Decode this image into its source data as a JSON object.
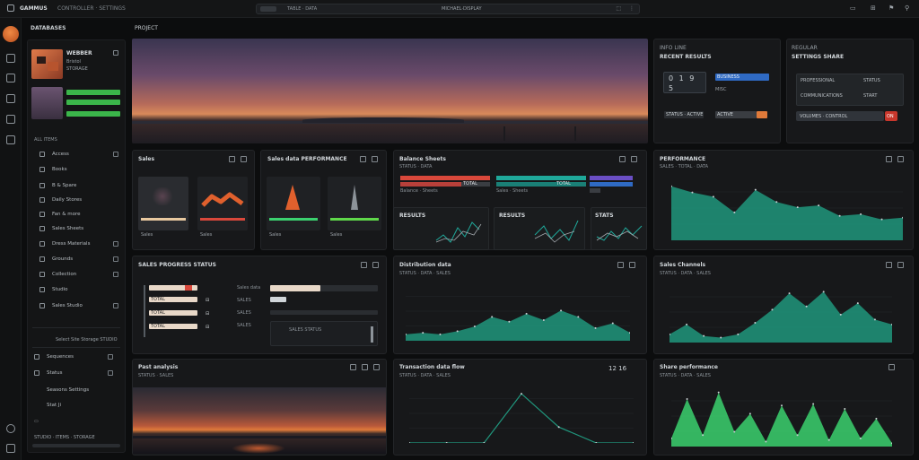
{
  "titlebar": {
    "app_name": "GAMMUS",
    "app_menu": "CONTROLLER · SETTINGS",
    "url_tab": "TABLE · DATA",
    "url_address": "MICHAEL·DISPLAY",
    "url_right_1": "⬚",
    "url_right_2": "⋮",
    "win_controls": [
      "▭",
      "⊞",
      "⚑",
      "⚲"
    ]
  },
  "sidebar": {
    "title": "DATABASES",
    "profile_name": "WEBBER",
    "profile_sub1": "Bristol",
    "profile_sub2": "STORAGE",
    "section": "ALL ITEMS",
    "items": [
      {
        "label": "Access"
      },
      {
        "label": "Books"
      },
      {
        "label": "B & Spare"
      },
      {
        "label": "Daily Stores"
      },
      {
        "label": "Fan & more"
      },
      {
        "label": "Sales Sheets"
      },
      {
        "label": "Dress Materials"
      },
      {
        "label": "Grounds"
      },
      {
        "label": "Collection"
      },
      {
        "label": "Studio"
      },
      {
        "label": "Sales Studio"
      }
    ],
    "footer_line": "Select Site Storage STUDIO",
    "footer_items": [
      {
        "label": "Sequences"
      },
      {
        "label": "Status"
      },
      {
        "label": "Seasons Settings"
      },
      {
        "label": "Stat Ji"
      }
    ],
    "footer_caption": "STUDIO · ITEMS · STORAGE"
  },
  "main": {
    "title": "PROJECT"
  },
  "panel_right_top1": {
    "title": "INFO LINE",
    "subtitle": "RECENT RESULTS",
    "digits": "0 1 9",
    "digits2": "5",
    "row1": "BUSINESS",
    "row2": "MISC",
    "row3": "STATUS · ACTIVE",
    "row4": "ACTIVE"
  },
  "panel_right_top2": {
    "title": "REGULAR",
    "subtitle": "SETTINGS SHARE",
    "line1": "PROFESSIONAL",
    "line1b": "STATUS",
    "line2": "COMMUNICATIONS",
    "line2b": "START",
    "line3": "VOLUMES · CONTROL",
    "line3b": "ON"
  },
  "card_b1": {
    "title": "Sales",
    "foot1": "Sales",
    "foot2": "Sales"
  },
  "card_b2": {
    "title": "Sales data PERFORMANCE",
    "foot1": "Sales",
    "foot2": "Sales"
  },
  "card_b3": {
    "title": "Balance Sheets",
    "subtitle": "STATUS · DATA",
    "bar1_label": "Balance · Sheets",
    "bar1_val": "TOTAL",
    "bar2_label": "Sales · Sheets",
    "bar2_val": "TOTAL",
    "mini1": "RESULTS",
    "mini2": "RESULTS",
    "mini3": "STATS"
  },
  "card_b4": {
    "title": "PERFORMANCE",
    "subtitle": "SALES · TOTAL · DATA"
  },
  "card_c1": {
    "title": "SALES PROGRESS STATUS",
    "rows": [
      "TOTAL",
      "TOTAL",
      "TOTAL"
    ],
    "right_title": "Sales data",
    "right_rows": [
      "SALES",
      "SALES",
      "SALES"
    ],
    "sub": "SALES STATUS"
  },
  "card_c2": {
    "title": "Distribution data",
    "subtitle": "STATUS · DATA · SALES"
  },
  "card_c3": {
    "title": "Sales Channels",
    "subtitle": "STATUS · DATA · SALES"
  },
  "card_d1": {
    "title": "Past analysis",
    "subtitle": "STATUS · SALES"
  },
  "card_d2": {
    "title": "Transaction data flow",
    "subtitle": "STATUS · DATA · SALES",
    "readout": "12 16"
  },
  "card_d3": {
    "title": "Share performance",
    "subtitle": "STATUS · DATA · SALES"
  },
  "colors": {
    "accent": "#20967d",
    "green": "#3bd16f",
    "red": "#d9483b",
    "teal": "#1fa89a",
    "blue": "#2f6ac4"
  },
  "chart_data": [
    {
      "type": "area",
      "name": "Performance",
      "values": [
        62,
        55,
        50,
        32,
        58,
        44,
        38,
        40,
        28,
        30,
        24,
        26
      ]
    },
    {
      "type": "area",
      "name": "Distribution data",
      "values": [
        8,
        10,
        8,
        12,
        18,
        30,
        24,
        34,
        26,
        38,
        30,
        16,
        22,
        10
      ]
    },
    {
      "type": "area",
      "name": "Sales Channels",
      "values": [
        10,
        22,
        8,
        6,
        10,
        24,
        40,
        60,
        44,
        62,
        34,
        48,
        28,
        22
      ]
    },
    {
      "type": "line",
      "name": "Transaction data flow",
      "values": [
        0,
        0,
        0,
        62,
        20,
        0,
        0
      ]
    },
    {
      "type": "area",
      "name": "Share performance",
      "values": [
        10,
        58,
        14,
        66,
        18,
        40,
        6,
        50,
        14,
        52,
        8,
        46,
        10,
        34,
        4
      ]
    }
  ]
}
